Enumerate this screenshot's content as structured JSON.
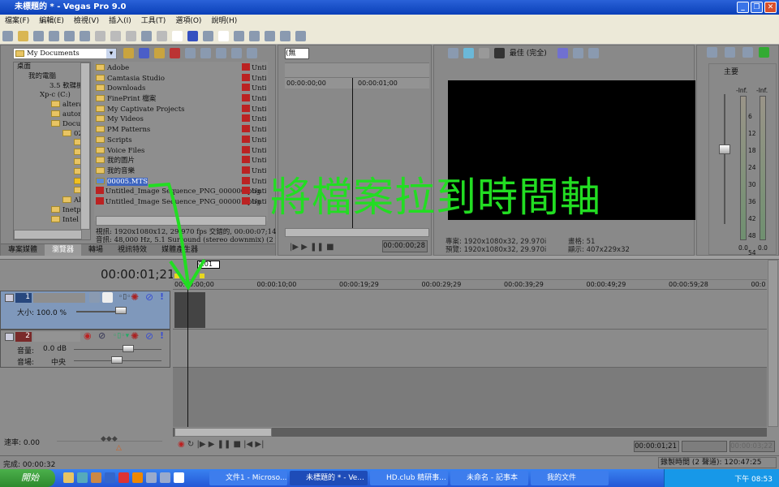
{
  "window": {
    "title": "未標題的 * - Vegas Pro 9.0",
    "min": "_",
    "max": "❐",
    "close": "✕"
  },
  "menu": [
    "檔案(F)",
    "編輯(E)",
    "檢視(V)",
    "插入(I)",
    "工具(T)",
    "選項(O)",
    "說明(H)"
  ],
  "explorer": {
    "path": "My Documents",
    "tree": [
      "桌面",
      "我的電腦",
      "3.5 軟碟機",
      "Xp-c (C:)",
      "altera",
      "autoru",
      "Docum",
      "02",
      "Al",
      "Inetpu",
      "Intel"
    ],
    "files": [
      "Adobe",
      "Camtasia Studio",
      "Downloads",
      "FinePrint 檔案",
      "My Captivate Projects",
      "My Videos",
      "PM Patterns",
      "Scripts",
      "Voice Files",
      "我的圖片",
      "我的音樂",
      "00005.MTS",
      "Untitled_Image Sequence_PNG_000000.png",
      "Untitled_Image Sequence_PNG_000001.png"
    ],
    "selected_file": "00005.MTS",
    "right_col": "Untit",
    "info_video": "視訊: 1920x1080x12, 29.970 fps 交錯的, 00:00:07;14, AV",
    "info_audio": "音訊: 48,000 Hz, 5.1 Surround (stereo downmix) (2 total st"
  },
  "tabs": [
    "專案媒體",
    "瀏覽器",
    "轉場",
    "視訊特效",
    "媒體產生器"
  ],
  "active_tab": "瀏覽器",
  "trimmer": {
    "dropdown": "(無",
    "ruler": [
      "00:00:00;00",
      "00:00:01;00"
    ],
    "time": "00:00:00;28"
  },
  "preview": {
    "quality": "最佳 (完全)",
    "project": "專案: 1920x1080x32, 29.970i",
    "preview": "預覽: 1920x1080x32, 29.970i",
    "frame": "畫格: 51",
    "display": "顯示: 407x229x32"
  },
  "mixer": {
    "label": "主要",
    "peaks": [
      "-Inf.",
      "-Inf."
    ],
    "scale": [
      "6",
      "12",
      "18",
      "24",
      "30",
      "36",
      "42",
      "48",
      "54"
    ],
    "values": [
      "0.0",
      "0.0"
    ]
  },
  "overlay": {
    "text": "將檔案拉到時間軸",
    "color": "#22dd22"
  },
  "timeline": {
    "cursor_time": "00:00:01;21",
    "marker": "0:01",
    "ruler": [
      "00:00:00;00",
      "00:00:10;00",
      "00:00:19;29",
      "00:00:29;29",
      "00:00:39;29",
      "00:00:49;29",
      "00:00:59;28",
      "00:0"
    ],
    "tracks": [
      {
        "num": "1",
        "type": "video",
        "param_label": "大小:",
        "param_value": "100.0 %"
      },
      {
        "num": "2",
        "type": "audio",
        "vol_label": "音量:",
        "vol_value": "0.0 dB",
        "pan_label": "音場:",
        "pan_value": "中央"
      }
    ],
    "rate": "速率: 0.00",
    "sel_start": "00:00:01;21",
    "sel_end": "00:00:03;22",
    "done": "完成: 00:00:32",
    "record": "錄製時間 (2 聲道): 120:47:25"
  },
  "taskbar": {
    "start": "開始",
    "tasks": [
      "文件1 - Microso...",
      "未標題的 * - Ve...",
      "HD.club 精研事...",
      "未命名 - 記事本",
      "我的文件"
    ],
    "clock": "下午 08:53"
  }
}
